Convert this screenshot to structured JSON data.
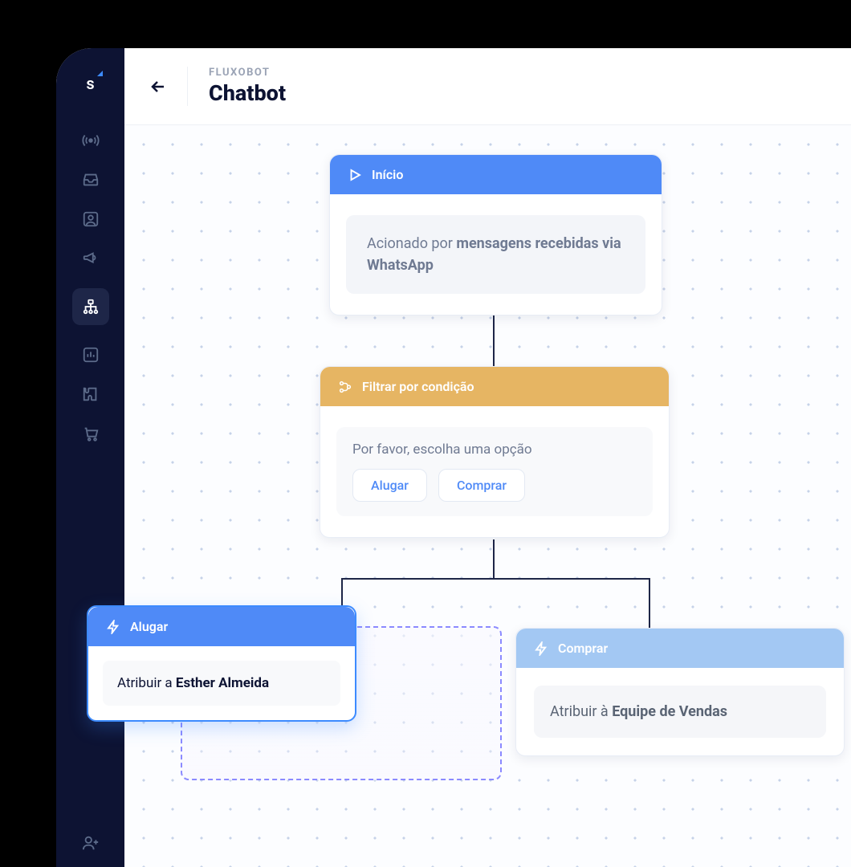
{
  "sidebar": {
    "logo": "s"
  },
  "header": {
    "kicker": "FLUXOBOT",
    "title": "Chatbot"
  },
  "nodes": {
    "start": {
      "title": "Início",
      "body_prefix": "Acionado por ",
      "body_bold": "mensagens recebidas via WhatsApp"
    },
    "filter": {
      "title": "Filtrar por condição",
      "prompt": "Por favor, escolha uma opção",
      "option1": "Alugar",
      "option2": "Comprar"
    },
    "branch_left": {
      "title": "Alugar",
      "assign_prefix": "Atribuir a ",
      "assign_bold": "Esther Almeida"
    },
    "branch_right": {
      "title": "Comprar",
      "assign_prefix": "Atribuir à ",
      "assign_bold": "Equipe de Vendas"
    }
  }
}
